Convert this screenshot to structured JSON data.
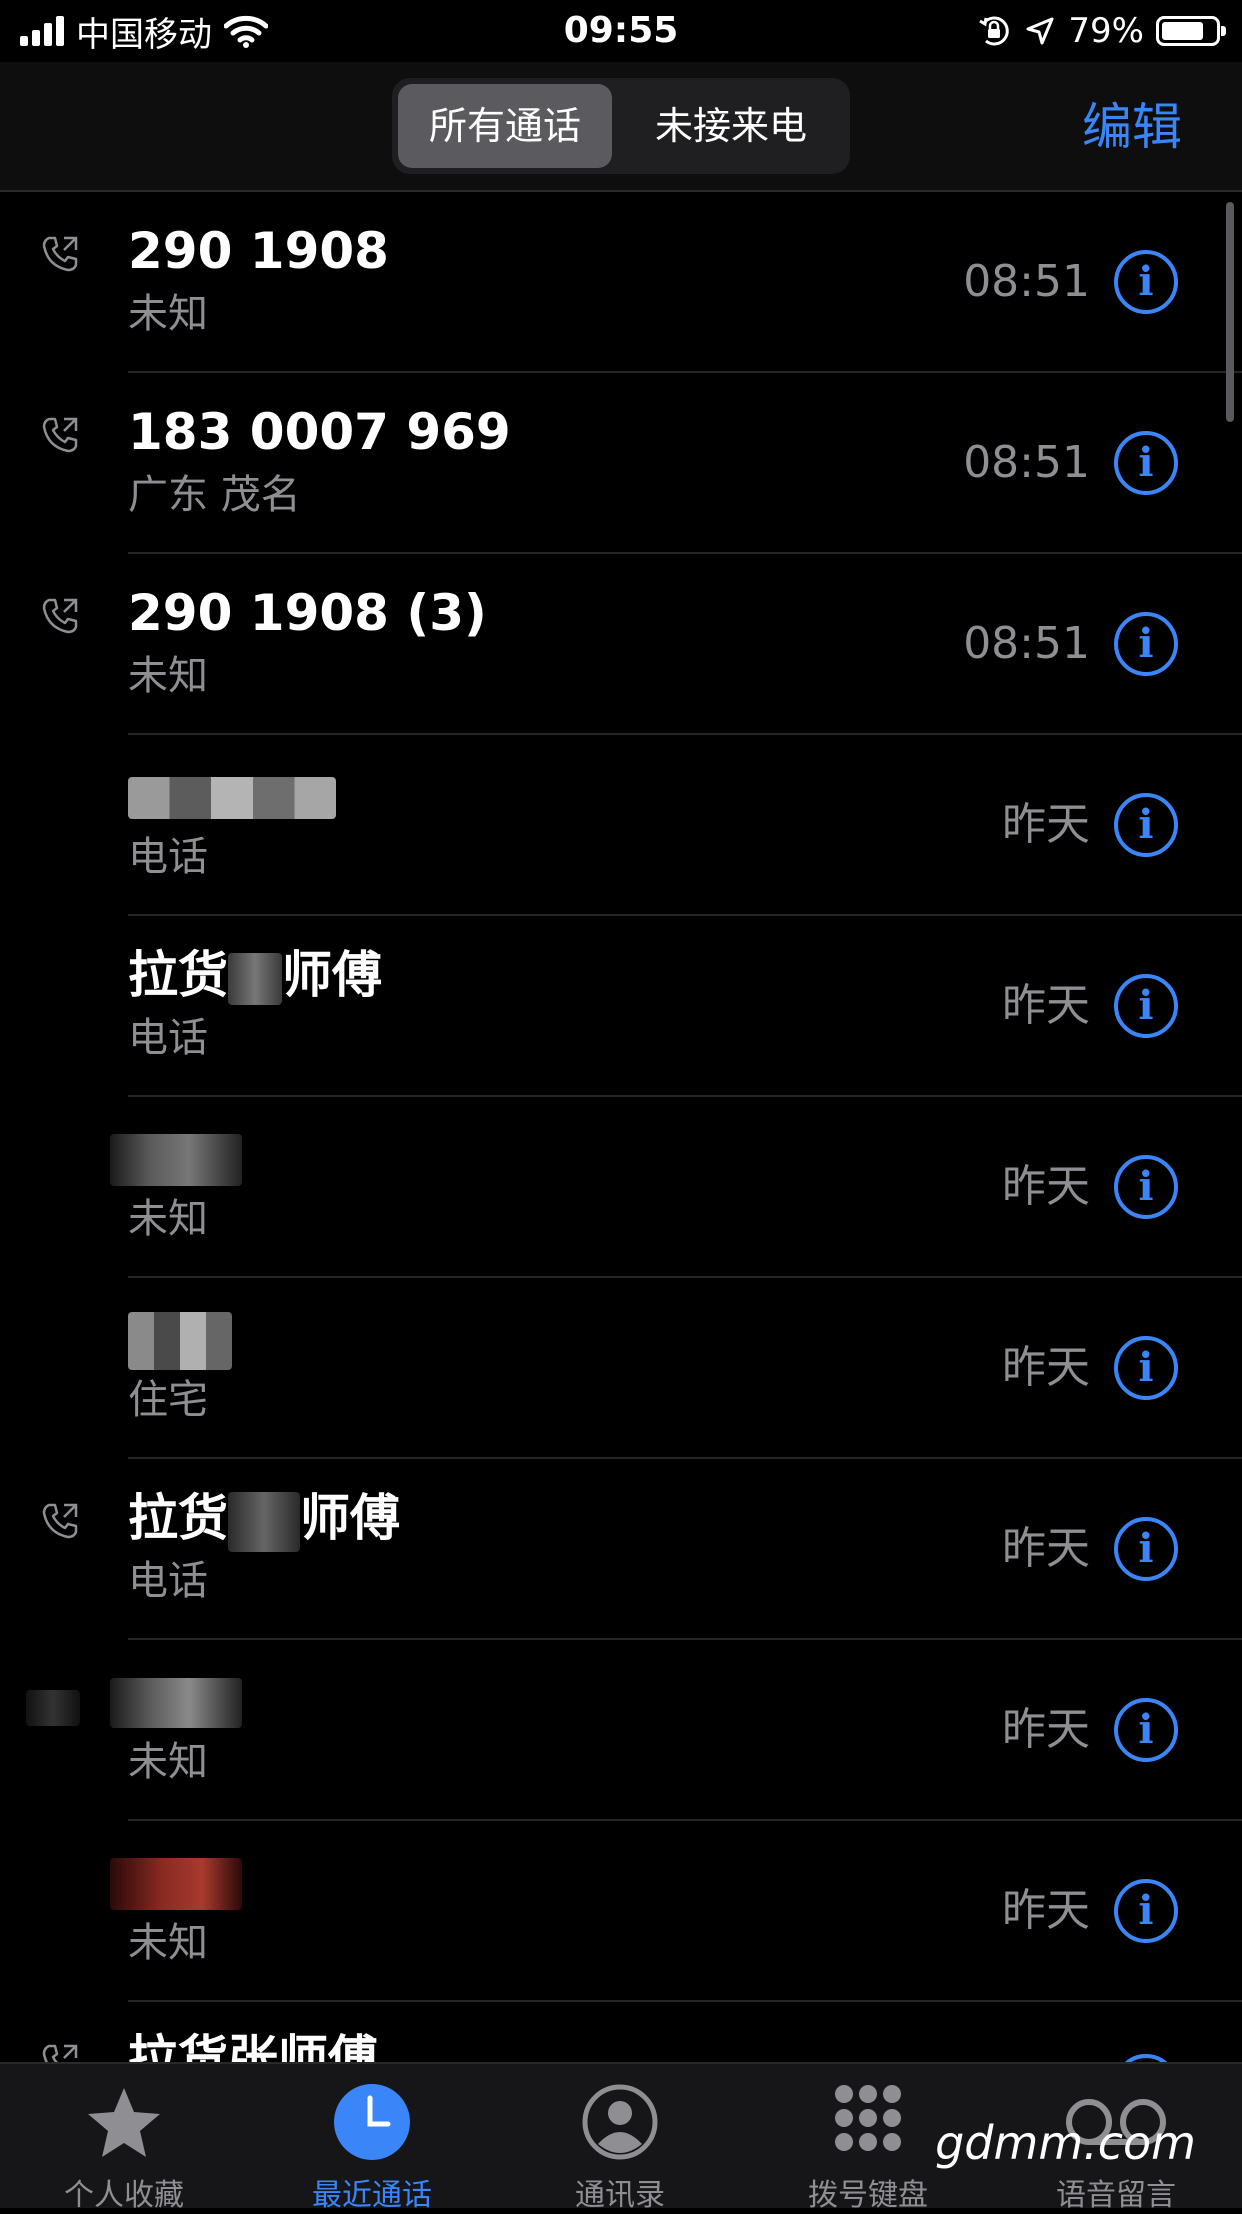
{
  "status_bar": {
    "carrier": "中国移动",
    "time": "09:55",
    "battery_text": "79%",
    "battery_level": 0.79
  },
  "nav": {
    "segments": [
      "所有通话",
      "未接来电"
    ],
    "selected_segment": "所有通话",
    "edit_label": "编辑"
  },
  "calls": [
    {
      "name": "290 1908",
      "subtitle": "未知",
      "time": "08:51",
      "outgoing": true
    },
    {
      "name": "183 0007 969",
      "subtitle": "广东 茂名",
      "time": "08:51",
      "outgoing": true
    },
    {
      "name": "290 1908 (3)",
      "subtitle": "未知",
      "time": "08:51",
      "outgoing": true
    },
    {
      "name": "",
      "subtitle": "电话",
      "time": "昨天",
      "outgoing": false,
      "name_redacted": true
    },
    {
      "name_prefix": "拉货",
      "name_suffix": "师傅",
      "subtitle": "电话",
      "time": "昨天",
      "outgoing": false,
      "name_redacted_middle": true
    },
    {
      "name": "",
      "subtitle": "未知",
      "time": "昨天",
      "outgoing": false,
      "name_redacted": true
    },
    {
      "name": "",
      "subtitle": "住宅",
      "time": "昨天",
      "outgoing": false,
      "name_redacted": true
    },
    {
      "name_prefix": "拉货",
      "name_suffix": "师傅",
      "subtitle": "电话",
      "time": "昨天",
      "outgoing": true,
      "name_redacted_middle": true
    },
    {
      "name": "",
      "subtitle": "未知",
      "time": "昨天",
      "outgoing": false,
      "name_redacted": true
    },
    {
      "name": "",
      "subtitle": "未知",
      "time": "昨天",
      "outgoing": false,
      "name_redacted": true
    }
  ],
  "partial_row_text": "拉货张师傅",
  "tabs": [
    {
      "label": "个人收藏",
      "icon": "star-icon",
      "active": false
    },
    {
      "label": "最近通话",
      "icon": "clock-icon",
      "active": true
    },
    {
      "label": "通讯录",
      "icon": "contact-icon",
      "active": false
    },
    {
      "label": "拨号键盘",
      "icon": "keypad-icon",
      "active": false
    },
    {
      "label": "语音留言",
      "icon": "voicemail-icon",
      "active": false
    }
  ],
  "watermark": "gdmm.com",
  "colors": {
    "accent": "#3a86f8",
    "secondary_text": "#8e8e93",
    "background": "#000000"
  }
}
